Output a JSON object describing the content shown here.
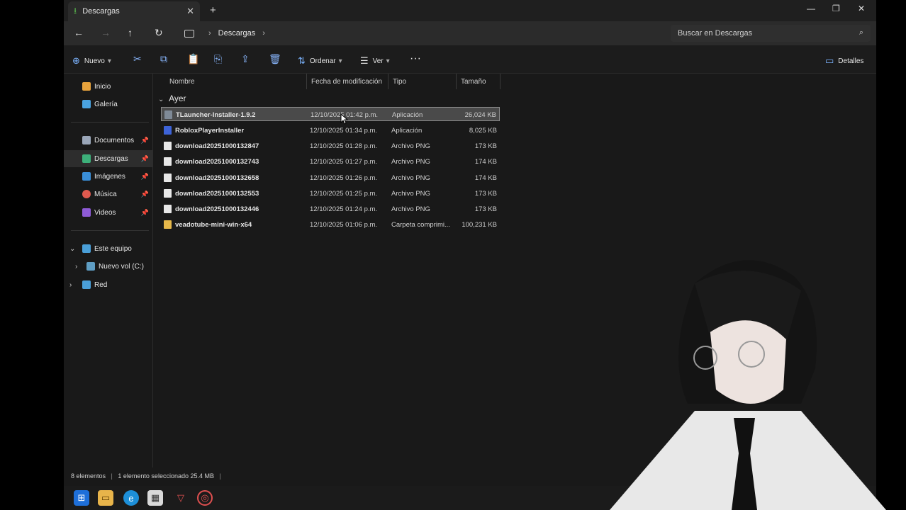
{
  "tab": {
    "title": "Descargas"
  },
  "address": {
    "location": "Descargas"
  },
  "search": {
    "placeholder": "Buscar en Descargas"
  },
  "toolbar": {
    "nuevo": "Nuevo",
    "ordenar": "Ordenar",
    "ver": "Ver",
    "detalles": "Detalles"
  },
  "sidebar": {
    "inicio": "Inicio",
    "galeria": "Galería",
    "documentos": "Documentos",
    "descargas": "Descargas",
    "imagenes": "Imágenes",
    "musica": "Música",
    "videos": "Videos",
    "este_equipo": "Este equipo",
    "nuevo_vol": "Nuevo vol (C:)",
    "red": "Red"
  },
  "columns": {
    "nombre": "Nombre",
    "fecha": "Fecha de modificación",
    "tipo": "Tipo",
    "tamano": "Tamaño"
  },
  "group": "Ayer",
  "files": [
    {
      "name": "TLauncher-Installer-1.9.2",
      "date": "12/10/2025 01:42 p.m.",
      "type": "Aplicación",
      "size": "26,024 KB"
    },
    {
      "name": "RobloxPlayerInstaller",
      "date": "12/10/2025 01:34 p.m.",
      "type": "Aplicación",
      "size": "8,025 KB"
    },
    {
      "name": "download20251000132847",
      "date": "12/10/2025 01:28 p.m.",
      "type": "Archivo PNG",
      "size": "173 KB"
    },
    {
      "name": "download20251000132743",
      "date": "12/10/2025 01:27 p.m.",
      "type": "Archivo PNG",
      "size": "174 KB"
    },
    {
      "name": "download20251000132658",
      "date": "12/10/2025 01:26 p.m.",
      "type": "Archivo PNG",
      "size": "174 KB"
    },
    {
      "name": "download20251000132553",
      "date": "12/10/2025 01:25 p.m.",
      "type": "Archivo PNG",
      "size": "173 KB"
    },
    {
      "name": "download20251000132446",
      "date": "12/10/2025 01:24 p.m.",
      "type": "Archivo PNG",
      "size": "173 KB"
    },
    {
      "name": "veadotube-mini-win-x64",
      "date": "12/10/2025 01:06 p.m.",
      "type": "Carpeta comprimi...",
      "size": "100,231 KB"
    }
  ],
  "status": {
    "count": "8 elementos",
    "selected": "1 elemento seleccionado  25.4 MB"
  }
}
